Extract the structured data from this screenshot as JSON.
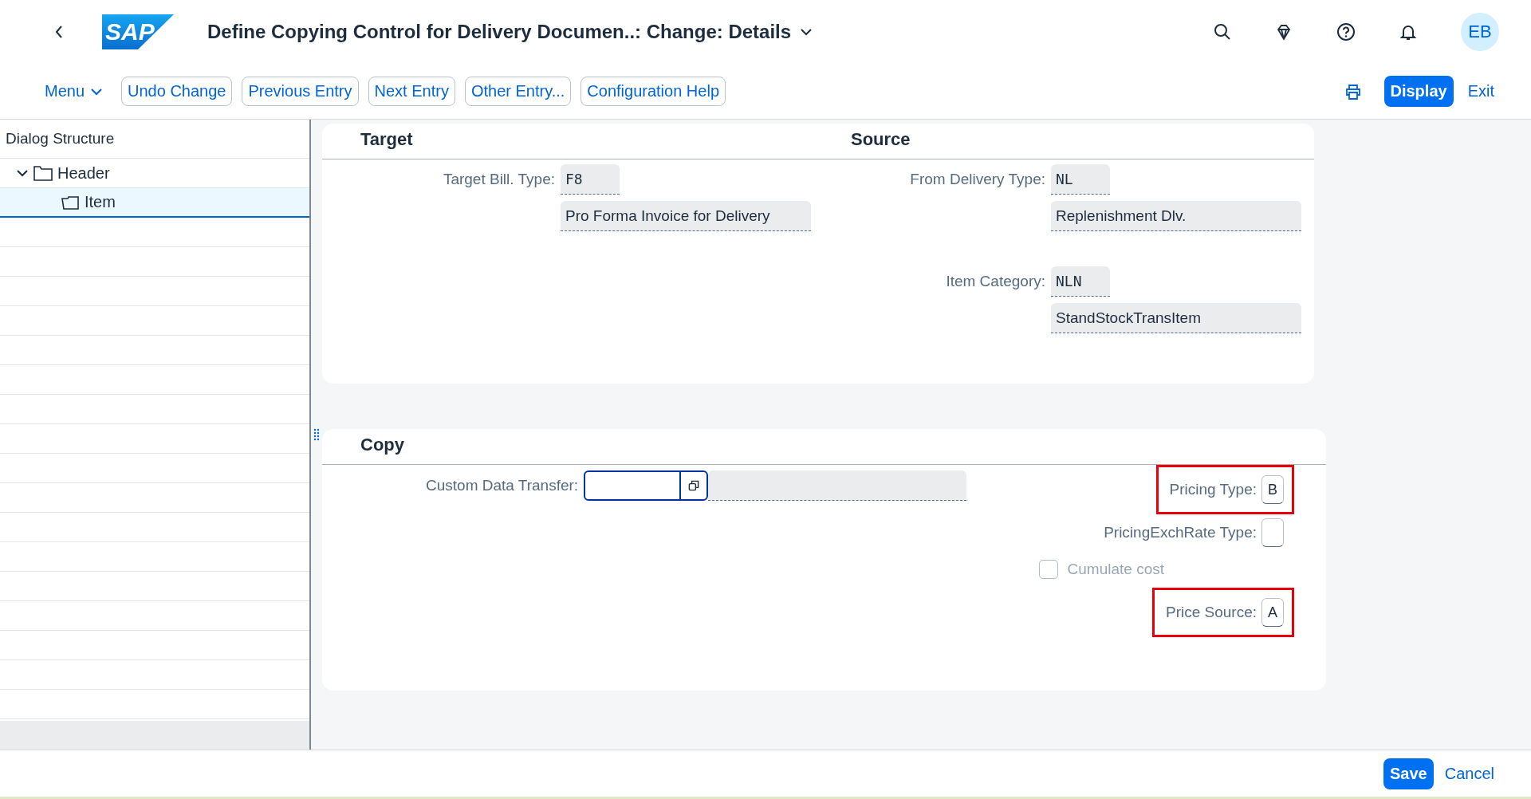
{
  "shell": {
    "logo": "SAP",
    "title": "Define Copying Control for Delivery Documen..: Change: Details",
    "avatar": "EB"
  },
  "toolbar": {
    "menu": "Menu",
    "buttons": [
      "Undo Change",
      "Previous Entry",
      "Next Entry",
      "Other Entry...",
      "Configuration Help"
    ],
    "actions": [
      {
        "label": "Display",
        "kind": "emphasized"
      },
      {
        "label": "Exit",
        "kind": "transparent"
      }
    ]
  },
  "dialog_structure": {
    "title": "Dialog Structure",
    "tree": [
      {
        "label": "Header",
        "expanded": true,
        "selected": false,
        "children": [
          {
            "label": "Item",
            "selected": true
          }
        ]
      }
    ]
  },
  "target": {
    "title": "Target",
    "fields": [
      {
        "label": "Target Bill. Type:",
        "code": "F8",
        "description": "Pro Forma Invoice for Delivery"
      }
    ]
  },
  "source": {
    "title": "Source",
    "fields": [
      {
        "label": "From Delivery Type:",
        "code": "NL",
        "description": "Replenishment Dlv."
      },
      {
        "label": "Item Category:",
        "code": "NLN",
        "description": "StandStockTransItem"
      }
    ]
  },
  "copy": {
    "title": "Copy",
    "custom_data_transfer": {
      "label": "Custom Data Transfer:"
    },
    "right_fields": [
      {
        "kind": "input",
        "label": "Pricing Type:",
        "value": "B",
        "highlighted": true
      },
      {
        "kind": "input",
        "label": "PricingExchRate Type:",
        "highlighted": false
      },
      {
        "kind": "checkbox",
        "label": "Cumulate cost",
        "checked": false,
        "disabled": true,
        "highlighted": false
      },
      {
        "kind": "input",
        "label": "Price Source:",
        "value": "A",
        "highlighted": true
      }
    ]
  },
  "footer": {
    "buttons": [
      {
        "label": "Save",
        "kind": "emphasized"
      },
      {
        "label": "Cancel",
        "kind": "transparent"
      }
    ]
  }
}
